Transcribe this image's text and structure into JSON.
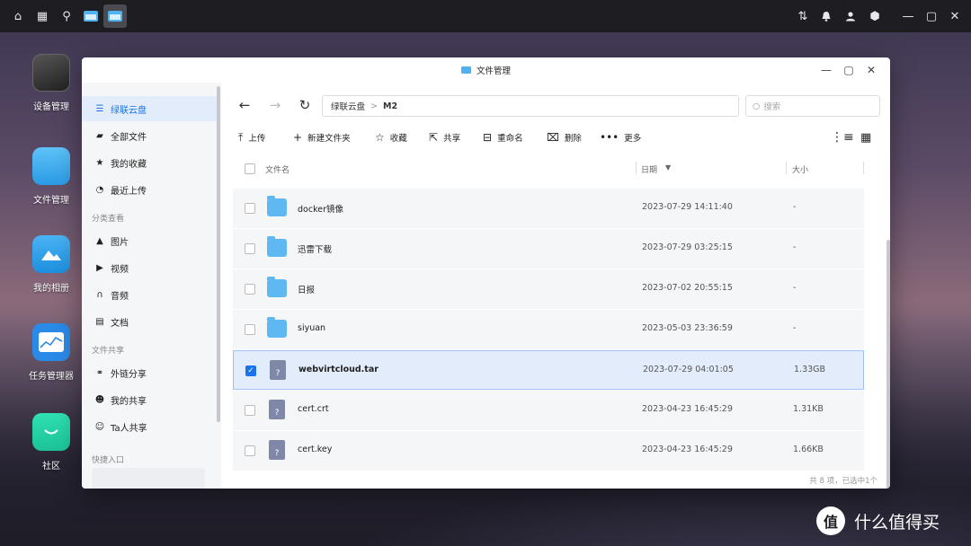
{
  "window": {
    "title": "文件管理"
  },
  "dock": [
    {
      "label": "设备管理"
    },
    {
      "label": "文件管理"
    },
    {
      "label": "我的相册"
    },
    {
      "label": "任务管理器"
    },
    {
      "label": "社区"
    }
  ],
  "sidebar": {
    "top_items": [
      {
        "label": "绿联云盘",
        "icon": "drive-icon"
      },
      {
        "label": "全部文件",
        "icon": "folder-icon"
      },
      {
        "label": "我的收藏",
        "icon": "star-icon"
      },
      {
        "label": "最近上传",
        "icon": "clock-icon"
      }
    ],
    "section_category": "分类查看",
    "category_items": [
      {
        "label": "图片",
        "icon": "image-icon"
      },
      {
        "label": "视频",
        "icon": "video-icon"
      },
      {
        "label": "音频",
        "icon": "headphone-icon"
      },
      {
        "label": "文档",
        "icon": "document-icon"
      }
    ],
    "section_share": "文件共享",
    "share_items": [
      {
        "label": "外链分享",
        "icon": "link-icon"
      },
      {
        "label": "我的共享",
        "icon": "users-icon"
      },
      {
        "label": "Ta人共享",
        "icon": "user-share-icon"
      }
    ],
    "section_quick": "快捷入口"
  },
  "path": {
    "root": "绿联云盘",
    "separator": ">",
    "current": "M2"
  },
  "search": {
    "placeholder": "搜索"
  },
  "toolbar": {
    "upload": "上传",
    "new_folder": "新建文件夹",
    "favorite": "收藏",
    "share": "共享",
    "rename": "重命名",
    "delete": "删除",
    "more": "更多"
  },
  "table": {
    "col_name": "文件名",
    "col_date": "日期",
    "col_size": "大小",
    "rows": [
      {
        "name": "docker镜像",
        "date": "2023-07-29 14:11:40",
        "size": "-",
        "type": "folder",
        "selected": false
      },
      {
        "name": "迅雷下载",
        "date": "2023-07-29 03:25:15",
        "size": "-",
        "type": "folder",
        "selected": false
      },
      {
        "name": "日报",
        "date": "2023-07-02 20:55:15",
        "size": "-",
        "type": "folder",
        "selected": false
      },
      {
        "name": "siyuan",
        "date": "2023-05-03 23:36:59",
        "size": "-",
        "type": "folder",
        "selected": false
      },
      {
        "name": "webvirtcloud.tar",
        "date": "2023-07-29 04:01:05",
        "size": "1.33GB",
        "type": "file",
        "selected": true
      },
      {
        "name": "cert.crt",
        "date": "2023-04-23 16:45:29",
        "size": "1.31KB",
        "type": "file",
        "selected": false
      },
      {
        "name": "cert.key",
        "date": "2023-04-23 16:45:29",
        "size": "1.66KB",
        "type": "file",
        "selected": false
      }
    ]
  },
  "status": "共 8 项，已选中1个",
  "watermark": {
    "text": "什么值得买",
    "logo": "值"
  }
}
